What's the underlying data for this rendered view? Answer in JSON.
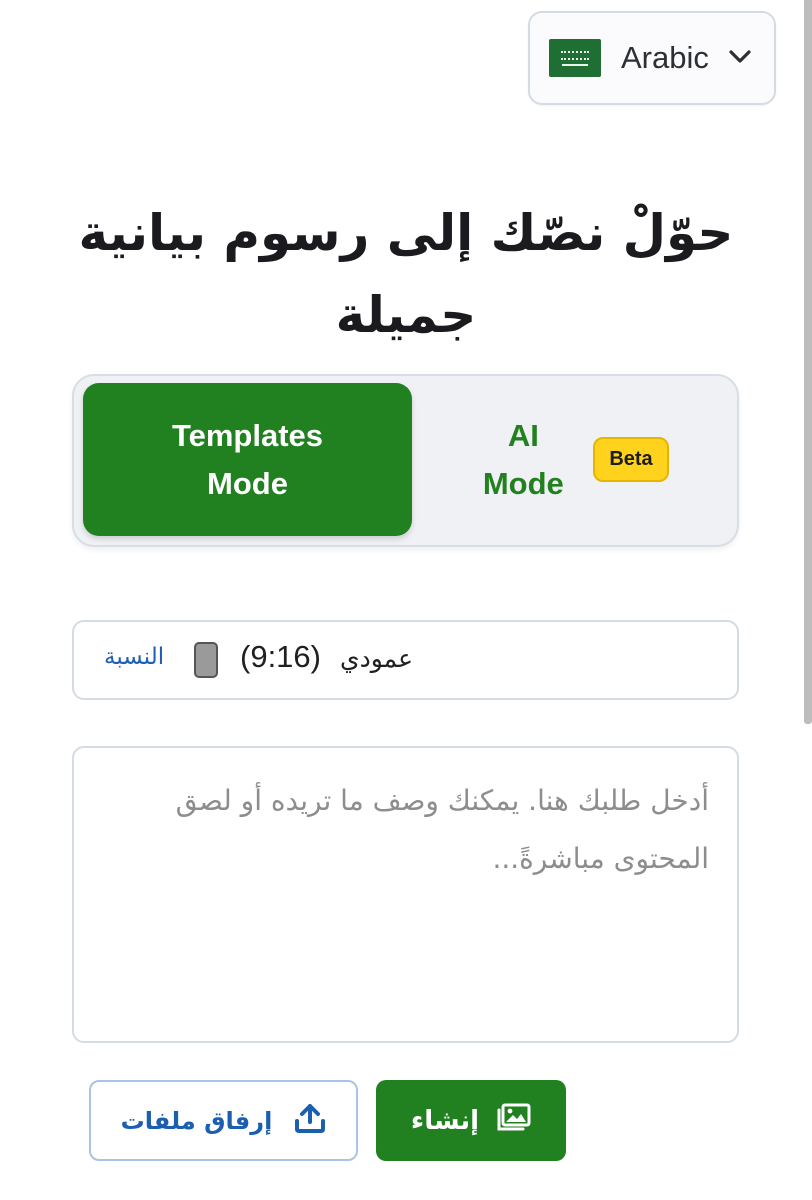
{
  "language_select": {
    "flag_icon": "saudi-flag-icon",
    "label": "Arabic",
    "chevron_icon": "chevron-down-icon"
  },
  "hero": {
    "title_line1": "حوّلْ نصّك إلى رسوم بيانية",
    "title_line2": "جميلة"
  },
  "mode_switch": {
    "templates_line1": "Templates",
    "templates_line2": "Mode",
    "ai_line1": "AI",
    "ai_line2": "Mode",
    "beta_badge": "Beta",
    "selected": "templates"
  },
  "ratio": {
    "label": "النسبة",
    "value": "(9:16)",
    "name": "عمودي"
  },
  "prompt": {
    "placeholder": "أدخل طلبك هنا. يمكنك وصف ما تريده أو لصق المحتوى مباشرةً...",
    "value": ""
  },
  "actions": {
    "attach_label": "إرفاق ملفات",
    "attach_icon": "upload-icon",
    "generate_label": "إنشاء",
    "generate_icon": "image-icon"
  },
  "colors": {
    "primary_green": "#21801f",
    "beta_yellow": "#ffd21d",
    "link_blue": "#1f5fb3"
  }
}
